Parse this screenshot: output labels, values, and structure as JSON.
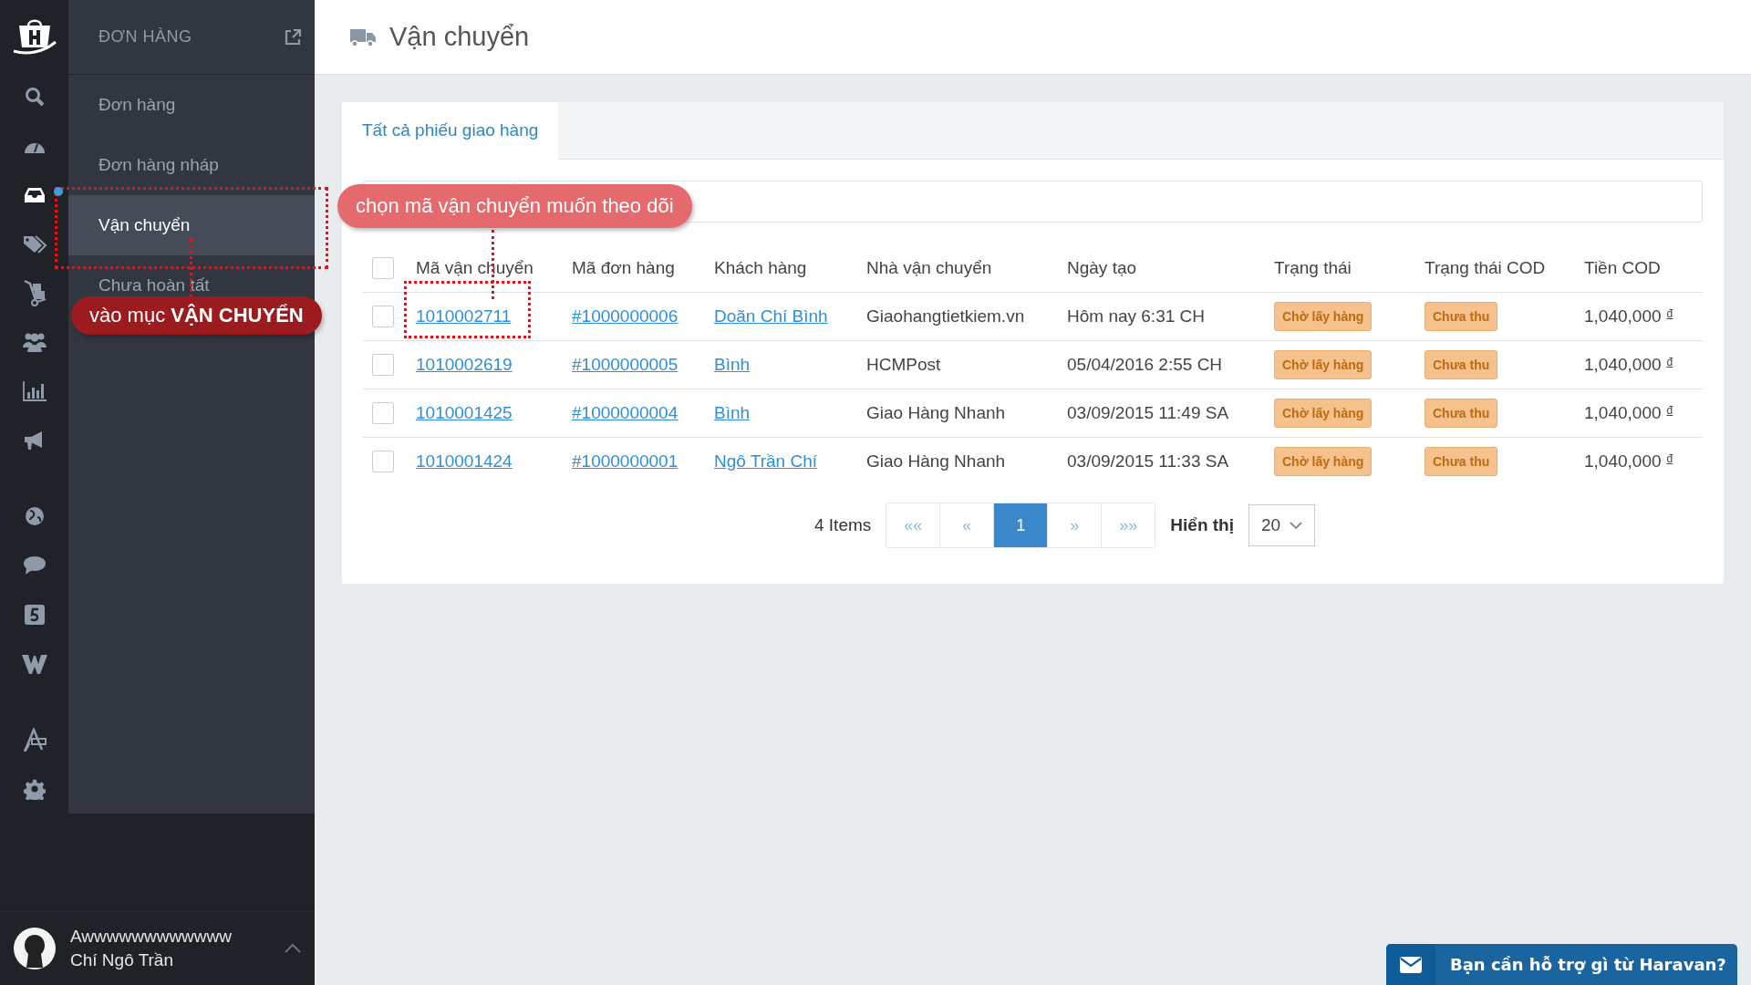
{
  "rail": [
    {
      "kind": "search",
      "selected": false
    },
    {
      "kind": "dashboard",
      "selected": false
    },
    {
      "kind": "inbox",
      "selected": true
    },
    {
      "kind": "tags",
      "selected": false
    },
    {
      "kind": "cart",
      "selected": false
    },
    {
      "kind": "users",
      "selected": false
    },
    {
      "kind": "chart",
      "selected": false
    },
    {
      "kind": "megaphone",
      "selected": false
    },
    {
      "kind": "globe",
      "selected": false
    },
    {
      "kind": "chat",
      "selected": false
    },
    {
      "kind": "five",
      "selected": false
    },
    {
      "kind": "w",
      "selected": false
    },
    {
      "kind": "brush",
      "selected": false
    },
    {
      "kind": "gear",
      "selected": false
    }
  ],
  "submenu": {
    "title": "ĐƠN HÀNG",
    "items": [
      {
        "label": "Đơn hàng",
        "selected": false
      },
      {
        "label": "Đơn hàng nháp",
        "selected": false
      },
      {
        "label": "Vận chuyển",
        "selected": true
      },
      {
        "label": "Chưa hoàn tất",
        "selected": false
      }
    ]
  },
  "user": {
    "store": "Awwwwwwwwwwww",
    "name": "Chí Ngô Trần"
  },
  "page": {
    "title": "Vận chuyển"
  },
  "tabs": [
    {
      "label": "Tất cả phiếu giao hàng",
      "selected": true
    }
  ],
  "table": {
    "header_checked": false,
    "columns": [
      "Mã vận chuyển",
      "Mã đơn hàng",
      "Khách hàng",
      "Nhà vận chuyển",
      "Ngày tạo",
      "Trạng thái",
      "Trạng thái COD",
      "Tiền COD"
    ],
    "rows": [
      {
        "checked": false,
        "ship_code": "1010002711",
        "order_code": "#1000000006",
        "customer": "Doãn Chí Bình",
        "carrier": "Giaohangtietkiem.vn",
        "created": "Hôm nay 6:31 CH",
        "status": "Chờ lấy hàng",
        "cod_status": "Chưa thu",
        "cod_amount": "1,040,000",
        "currency": "đ"
      },
      {
        "checked": false,
        "ship_code": "1010002619",
        "order_code": "#1000000005",
        "customer": "Bình",
        "carrier": "HCMPost",
        "created": "05/04/2016 2:55 CH",
        "status": "Chờ lấy hàng",
        "cod_status": "Chưa thu",
        "cod_amount": "1,040,000",
        "currency": "đ"
      },
      {
        "checked": false,
        "ship_code": "1010001425",
        "order_code": "#1000000004",
        "customer": "Bình",
        "carrier": "Giao Hàng Nhanh",
        "created": "03/09/2015 11:49 SA",
        "status": "Chờ lấy hàng",
        "cod_status": "Chưa thu",
        "cod_amount": "1,040,000",
        "currency": "đ"
      },
      {
        "checked": false,
        "ship_code": "1010001424",
        "order_code": "#1000000001",
        "customer": "Ngô Trần Chí",
        "carrier": "Giao Hàng Nhanh",
        "created": "03/09/2015 11:33 SA",
        "status": "Chờ lấy hàng",
        "cod_status": "Chưa thu",
        "cod_amount": "1,040,000",
        "currency": "đ"
      }
    ]
  },
  "pagination": {
    "count": "4 Items",
    "pages": [
      {
        "label": "««",
        "selected": false
      },
      {
        "label": "«",
        "selected": false
      },
      {
        "label": "1",
        "selected": true
      },
      {
        "label": "»",
        "selected": false
      },
      {
        "label": "»»",
        "selected": false
      }
    ],
    "page_size_label": "Hiển thị",
    "page_size": "20"
  },
  "help": {
    "label": "Bạn cần hỗ trợ gì từ Haravan?"
  },
  "annotations": [
    {
      "kind": "callout-light",
      "text": "chọn mã vận chuyển muốn theo dõi"
    },
    {
      "kind": "callout-dark",
      "text": "vào mục **VẬN CHUYỂN**"
    }
  ]
}
